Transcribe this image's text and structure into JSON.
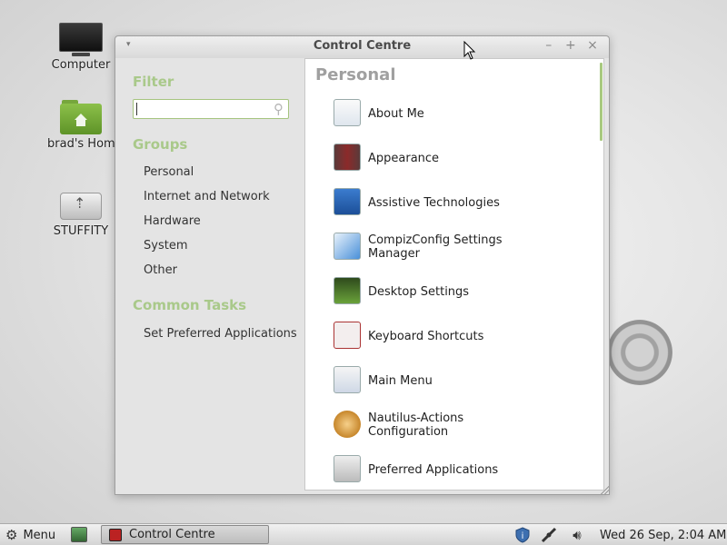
{
  "desktop": {
    "icons": [
      {
        "label": "Computer"
      },
      {
        "label": "brad's Home"
      },
      {
        "label": "STUFFITY"
      }
    ]
  },
  "window": {
    "title": "Control Centre",
    "controls": {
      "menu": "▾",
      "minimize": "–",
      "maximize": "+",
      "close": "×"
    }
  },
  "sidebar": {
    "filter_heading": "Filter",
    "search_value": "",
    "groups_heading": "Groups",
    "groups": [
      "Personal",
      "Internet and Network",
      "Hardware",
      "System",
      "Other"
    ],
    "common_tasks_heading": "Common Tasks",
    "tasks": [
      "Set Preferred Applications"
    ]
  },
  "main": {
    "section_title": "Personal",
    "items": [
      {
        "label": "About Me",
        "icon": "about-me-icon"
      },
      {
        "label": "Appearance",
        "icon": "appearance-icon"
      },
      {
        "label": "Assistive Technologies",
        "icon": "accessibility-icon"
      },
      {
        "label": "CompizConfig Settings Manager",
        "icon": "compiz-icon"
      },
      {
        "label": "Desktop Settings",
        "icon": "desktop-settings-icon"
      },
      {
        "label": "Keyboard Shortcuts",
        "icon": "keyboard-icon"
      },
      {
        "label": "Main Menu",
        "icon": "main-menu-icon"
      },
      {
        "label": "Nautilus-Actions Configuration",
        "icon": "nautilus-actions-icon"
      },
      {
        "label": "Preferred Applications",
        "icon": "preferred-apps-icon"
      }
    ]
  },
  "taskbar": {
    "menu_label": "Menu",
    "task_label": "Control Centre",
    "clock": "Wed 26 Sep,  2:04 AM"
  },
  "colors": {
    "accent": "#a9c98a",
    "panel_bg": "#ffffff",
    "window_bg": "#e4e4e4"
  }
}
